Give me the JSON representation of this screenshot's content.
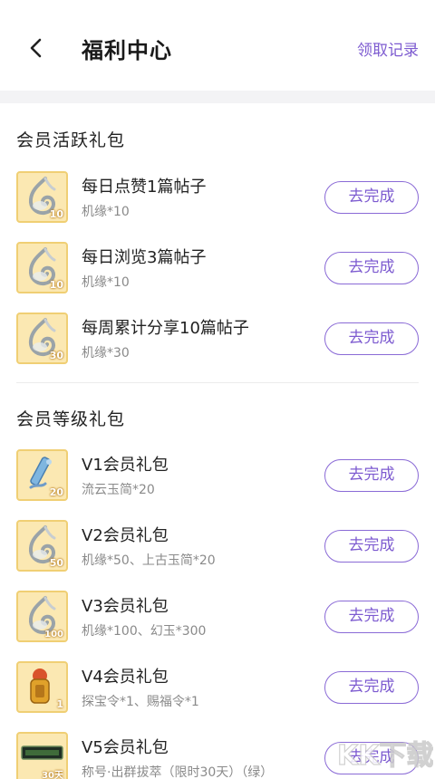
{
  "header": {
    "title": "福利中心",
    "record_link": "领取记录"
  },
  "colors": {
    "accent": "#7d5bd0",
    "thumb_bg": "#fbe8b2",
    "thumb_border": "#f0cf74"
  },
  "sections": [
    {
      "title": "会员活跃礼包",
      "items": [
        {
          "name": "每日点赞1篇帖子",
          "reward": "机缘*10",
          "badge": "10",
          "icon": "spirit-swirl-icon",
          "button": "去完成"
        },
        {
          "name": "每日浏览3篇帖子",
          "reward": "机缘*10",
          "badge": "10",
          "icon": "spirit-swirl-icon",
          "button": "去完成"
        },
        {
          "name": "每周累计分享10篇帖子",
          "reward": "机缘*30",
          "badge": "30",
          "icon": "spirit-swirl-icon",
          "button": "去完成"
        }
      ]
    },
    {
      "title": "会员等级礼包",
      "items": [
        {
          "name": "V1会员礼包",
          "reward": "流云玉简*20",
          "badge": "20",
          "icon": "jade-slip-icon",
          "button": "去完成"
        },
        {
          "name": "V2会员礼包",
          "reward": "机缘*50、上古玉简*20",
          "badge": "50",
          "icon": "spirit-swirl-icon",
          "button": "去完成"
        },
        {
          "name": "V3会员礼包",
          "reward": "机缘*100、幻玉*300",
          "badge": "100",
          "icon": "spirit-swirl-icon",
          "button": "去完成"
        },
        {
          "name": "V4会员礼包",
          "reward": "探宝令*1、赐福令*1",
          "badge": "1",
          "icon": "treasure-token-icon",
          "button": "去完成"
        },
        {
          "name": "V5会员礼包",
          "reward": "称号·出群拔萃（限时30天）（绿）",
          "badge": "30天",
          "icon": "title-plaque-icon",
          "button": "去完成"
        }
      ]
    }
  ],
  "watermark": "KK下载"
}
